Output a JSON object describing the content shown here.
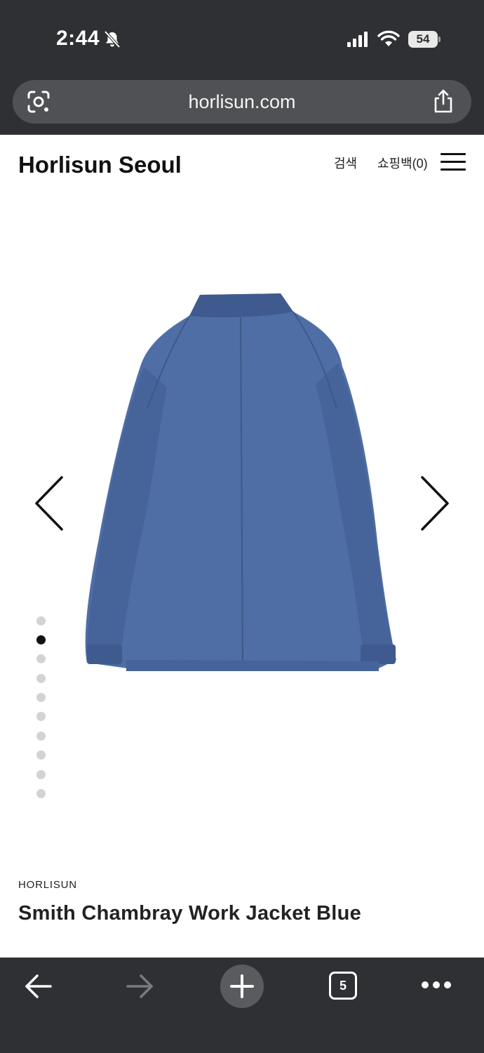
{
  "status_bar": {
    "time": "2:44",
    "battery": "54",
    "icons": [
      "bell-slash-icon",
      "signal-icon",
      "wifi-icon",
      "battery-icon"
    ]
  },
  "browser": {
    "url": "horlisun.com",
    "tab_count": "5",
    "icons": [
      "visual-lookup-icon",
      "share-icon",
      "back-arrow-icon",
      "forward-arrow-icon",
      "plus-icon",
      "more-icon"
    ]
  },
  "site": {
    "brand": "Horlisun Seoul",
    "nav": {
      "search_label": "검색",
      "bag_label": "쇼핑백(0)"
    }
  },
  "carousel": {
    "total_images": 10,
    "active_index": 1,
    "image_subject": "blue chambray work jacket, back view"
  },
  "product": {
    "brand": "HORLISUN",
    "title": "Smith Chambray Work Jacket Blue"
  },
  "colors": {
    "chrome": "#2f3033",
    "url_bar": "#505155",
    "jacket_blue": "#4f6ea6",
    "dot_active": "#111111",
    "dot_inactive": "#d3d3d3"
  }
}
